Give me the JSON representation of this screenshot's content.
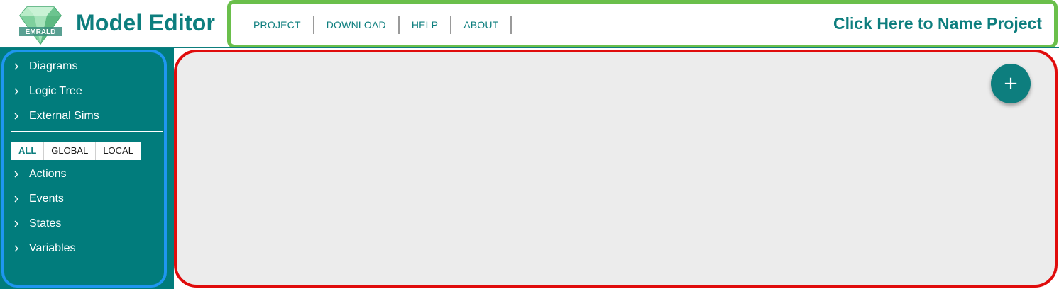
{
  "app": {
    "logo_text": "EMRALD",
    "title": "Model Editor"
  },
  "nav": {
    "items": [
      "PROJECT",
      "DOWNLOAD",
      "HELP",
      "ABOUT"
    ],
    "project_name": "Click Here to Name Project"
  },
  "sidebar": {
    "top_items": [
      {
        "label": "Diagrams",
        "icon": "chevron-right-icon"
      },
      {
        "label": "Logic Tree",
        "icon": "chevron-right-icon"
      },
      {
        "label": "External Sims",
        "icon": "chevron-right-icon"
      }
    ],
    "scope_tabs": [
      {
        "label": "ALL",
        "active": true
      },
      {
        "label": "GLOBAL",
        "active": false
      },
      {
        "label": "LOCAL",
        "active": false
      }
    ],
    "bottom_items": [
      {
        "label": "Actions",
        "icon": "chevron-right-icon"
      },
      {
        "label": "Events",
        "icon": "chevron-right-icon"
      },
      {
        "label": "States",
        "icon": "chevron-right-icon"
      },
      {
        "label": "Variables",
        "icon": "chevron-right-icon"
      }
    ]
  },
  "canvas": {
    "add_button_symbol": "+",
    "add_button_icon": "plus-icon"
  },
  "colors": {
    "brand_teal": "#0d7e7e",
    "sidebar_bg": "#017c7c",
    "canvas_bg": "#ececec",
    "nav_highlight": "#6abf4b",
    "sidebar_highlight": "#1e96f0",
    "canvas_highlight": "#e00c0c"
  }
}
